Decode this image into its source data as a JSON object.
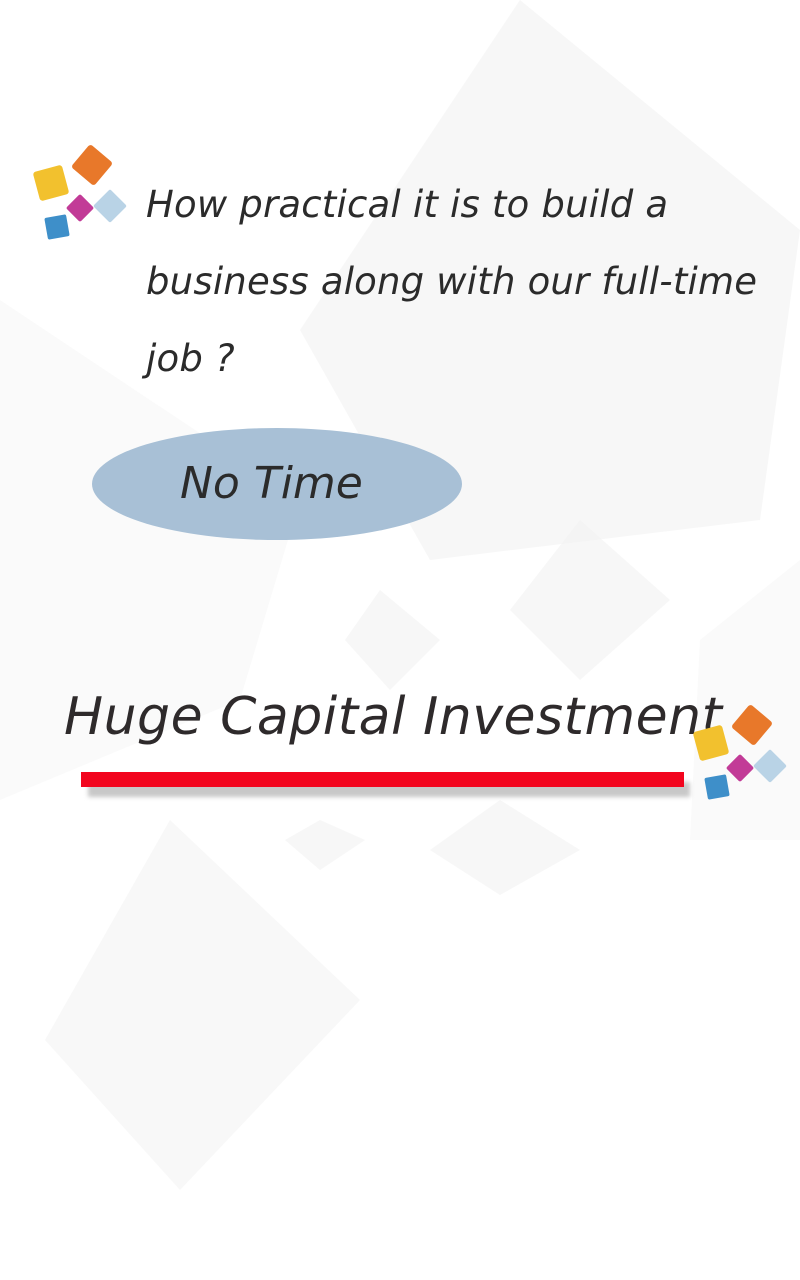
{
  "question": {
    "text": "How practical it is to build a business along with our full-time job ?"
  },
  "answer": {
    "text": "No Time"
  },
  "heading": {
    "text": "Huge Capital Investment"
  },
  "decoration": {
    "icon": "colored-cubes-icon",
    "cube_colors": [
      "#f2c12e",
      "#e8782a",
      "#c23b97",
      "#3e8fc9",
      "#b9d3e6"
    ],
    "oval_color": "#a8c0d6",
    "underline_color": "#f2051e",
    "text_color": "#2b2b2b"
  }
}
